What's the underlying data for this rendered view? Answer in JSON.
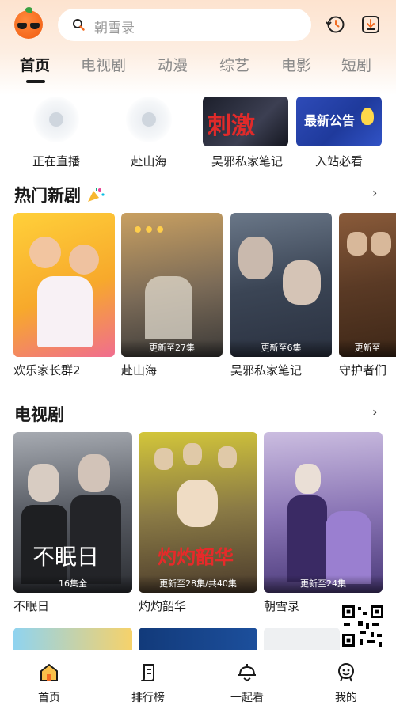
{
  "header": {
    "search_placeholder": "朝雪录",
    "icons": [
      "app-logo-icon",
      "search-icon",
      "history-icon",
      "download-icon"
    ]
  },
  "tabs": [
    {
      "label": "首页",
      "active": true
    },
    {
      "label": "电视剧",
      "active": false
    },
    {
      "label": "动漫",
      "active": false
    },
    {
      "label": "综艺",
      "active": false
    },
    {
      "label": "电影",
      "active": false
    },
    {
      "label": "短剧",
      "active": false
    }
  ],
  "quick_links": [
    {
      "label": "正在直播"
    },
    {
      "label": "赴山海"
    },
    {
      "label": "吴邪私家笔记",
      "thumb_text": "刺激"
    },
    {
      "label": "入站必看",
      "thumb_text": "最新公告"
    }
  ],
  "hot_section": {
    "title": "热门新剧",
    "more": "›",
    "items": [
      {
        "title": "欢乐家长群2"
      },
      {
        "title": "赴山海",
        "badge": "更新至27集"
      },
      {
        "title": "吴邪私家笔记",
        "badge": "更新至6集"
      },
      {
        "title": "守护者们",
        "badge": "更新至"
      }
    ]
  },
  "tv_section": {
    "title": "电视剧",
    "more": "›",
    "items": [
      {
        "title": "不眠日",
        "badge": "16集全",
        "poster_text": "不眠日"
      },
      {
        "title": "灼灼韶华",
        "badge": "更新至28集/共40集",
        "poster_text": "灼灼韶华"
      },
      {
        "title": "朝雪录",
        "badge": "更新至24集"
      }
    ]
  },
  "bottom_nav": [
    {
      "label": "首页",
      "icon": "home-icon",
      "active": true
    },
    {
      "label": "排行榜",
      "icon": "ranking-icon",
      "active": false
    },
    {
      "label": "一起看",
      "icon": "watch-together-icon",
      "active": false
    },
    {
      "label": "我的",
      "icon": "profile-icon",
      "active": false
    }
  ],
  "colors": {
    "accent": "#f26b21",
    "header_gradient": "#fde3cf",
    "text": "#1a1a1a",
    "tab_inactive": "#8a8a8a"
  }
}
